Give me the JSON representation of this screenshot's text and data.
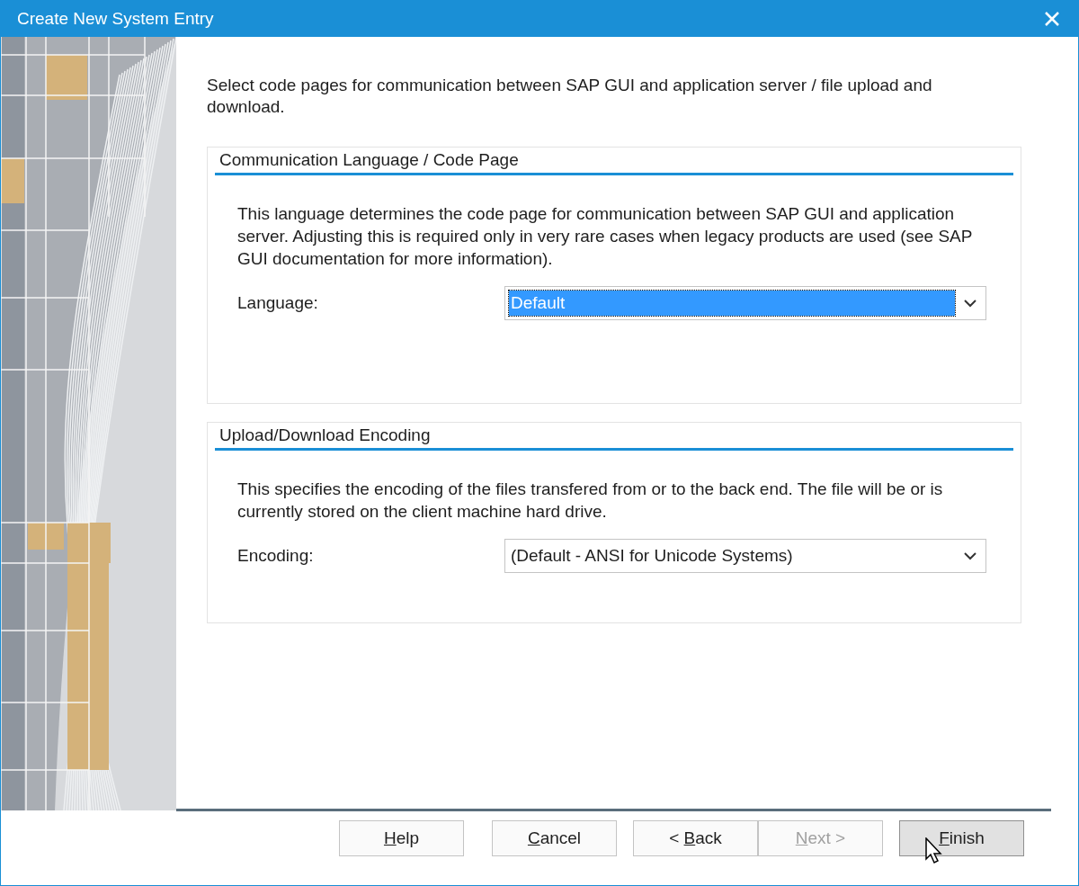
{
  "window": {
    "title": "Create New System Entry"
  },
  "intro": "Select code pages for communication between SAP GUI and application server / file upload and download.",
  "groups": [
    {
      "title": "Communication Language / Code Page",
      "description": "This language determines the code page for communication between SAP GUI and application server. Adjusting this is required only in very rare cases when legacy products are used (see SAP GUI documentation for more information).",
      "field": {
        "label": "Language:",
        "value": "Default",
        "focused": true
      }
    },
    {
      "title": "Upload/Download Encoding",
      "description": "This specifies the encoding of the files transfered from or to the back end. The file will be or is currently stored on the client machine hard drive.",
      "field": {
        "label": "Encoding:",
        "value": "(Default - ANSI for Unicode Systems)",
        "focused": false
      }
    }
  ],
  "buttons": [
    {
      "key": "H",
      "after": "elp",
      "disabled": false,
      "hovered": false
    },
    {
      "key": "C",
      "after": "ancel",
      "disabled": false,
      "hovered": false
    },
    {
      "before": "< ",
      "key": "B",
      "after": "ack",
      "disabled": false,
      "hovered": false
    },
    {
      "key": "N",
      "after": "ext >",
      "disabled": true,
      "hovered": false
    },
    {
      "key": "F",
      "after": "inish",
      "disabled": false,
      "hovered": true
    }
  ]
}
